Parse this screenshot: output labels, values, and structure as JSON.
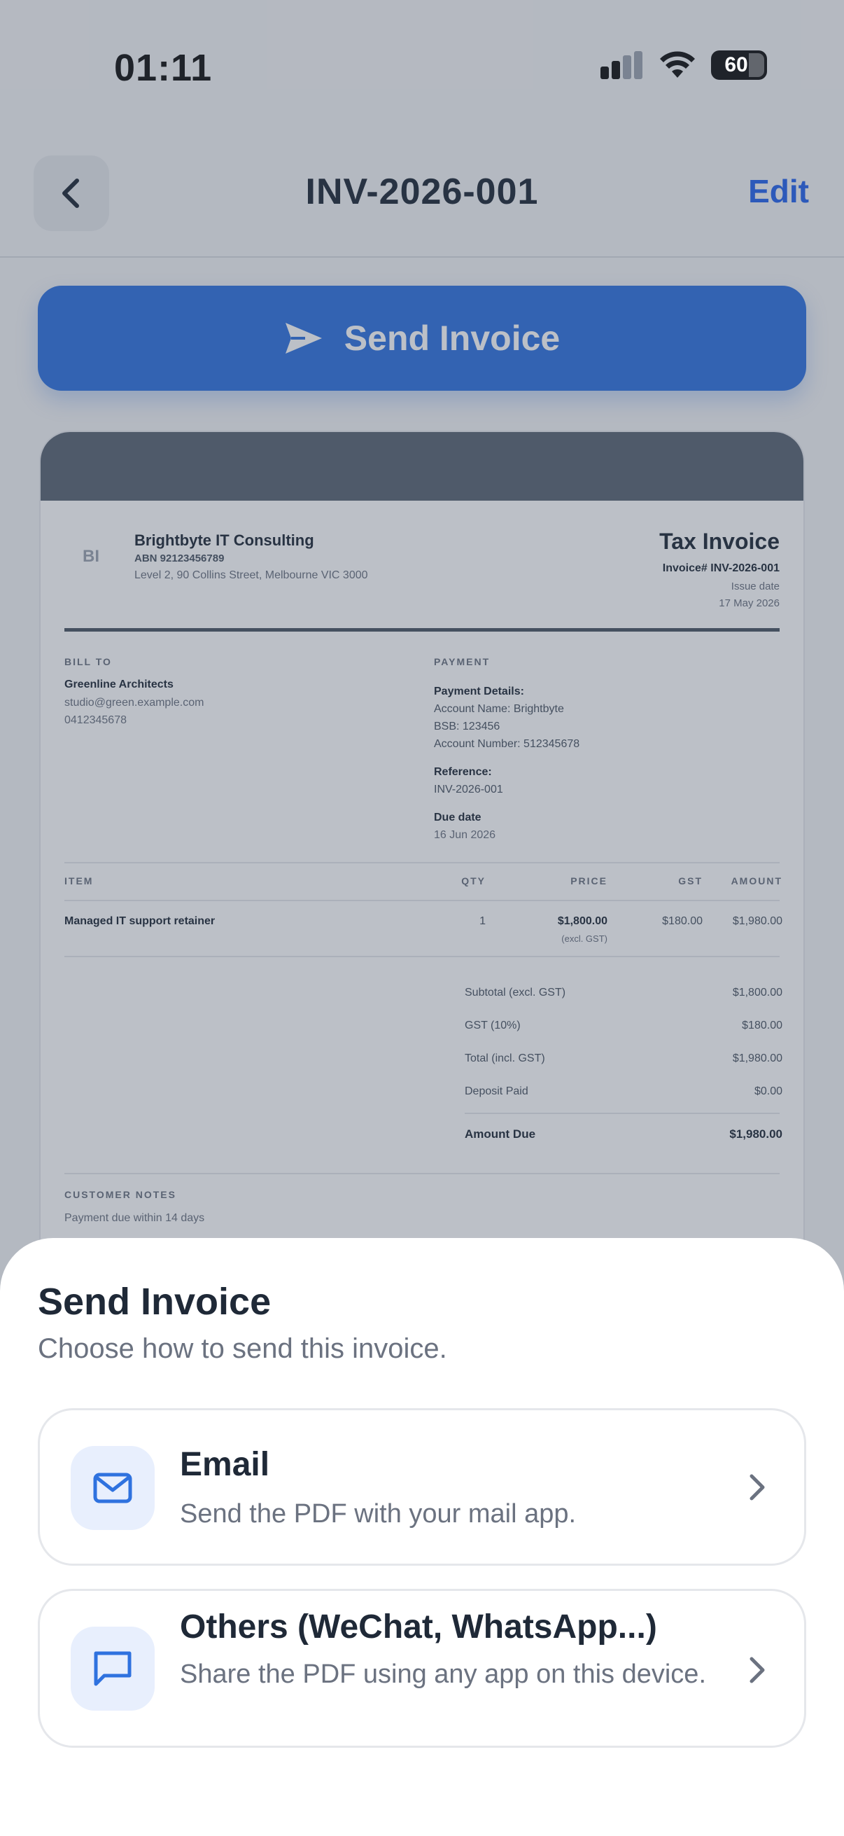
{
  "status_bar": {
    "time": "01:11",
    "battery": "60",
    "icons": [
      "signal-icon",
      "wifi-icon",
      "battery-icon"
    ]
  },
  "nav": {
    "title": "INV-2026-001",
    "edit_label": "Edit",
    "back_icon": "chevron-left-icon"
  },
  "send_button": {
    "label": "Send Invoice",
    "icon": "paper-plane-icon"
  },
  "invoice": {
    "logo_initials": "BI",
    "company": {
      "name": "Brightbyte IT Consulting",
      "abn": "ABN 92123456789",
      "address": "Level 2, 90 Collins Street, Melbourne VIC 3000"
    },
    "doc_title": "Tax Invoice",
    "invoice_number": "Invoice# INV-2026-001",
    "issue_label": "Issue date",
    "issue_date": "17 May 2026",
    "bill_to": {
      "label": "BILL TO",
      "name": "Greenline Architects",
      "email": "studio@green.example.com",
      "phone": "0412345678"
    },
    "payment": {
      "label": "PAYMENT",
      "details_label": "Payment Details:",
      "account_name": "Account Name: Brightbyte",
      "bsb": "BSB: 123456",
      "account_number": "Account Number: 512345678",
      "reference_label": "Reference:",
      "reference": "INV-2026-001",
      "due_label": "Due date",
      "due_date": "16 Jun 2026"
    },
    "columns": {
      "item": "ITEM",
      "qty": "QTY",
      "price": "PRICE",
      "gst": "GST",
      "amount": "AMOUNT"
    },
    "line_items": [
      {
        "item": "Managed IT support retainer",
        "qty": "1",
        "price": "$1,800.00",
        "price_note": "(excl. GST)",
        "gst": "$180.00",
        "amount": "$1,980.00"
      }
    ],
    "totals": {
      "subtotal_label": "Subtotal (excl. GST)",
      "subtotal": "$1,800.00",
      "gst_label": "GST (10%)",
      "gst": "$180.00",
      "total_label": "Total (incl. GST)",
      "total": "$1,980.00",
      "deposit_label": "Deposit Paid",
      "deposit": "$0.00",
      "due_label": "Amount Due",
      "due": "$1,980.00"
    },
    "notes": {
      "label": "CUSTOMER NOTES",
      "text": "Payment due within 14 days"
    }
  },
  "sheet": {
    "title": "Send Invoice",
    "subtitle": "Choose how to send this invoice.",
    "options": [
      {
        "title": "Email",
        "description": "Send the PDF with your mail app.",
        "icon": "mail-icon"
      },
      {
        "title": "Others (WeChat, WhatsApp...)",
        "description": "Share the PDF using any app on this device.",
        "icon": "message-icon"
      }
    ]
  },
  "colors": {
    "accent": "#2f72df",
    "icon_bg": "#e8effd",
    "header_band": "#5a6472"
  }
}
